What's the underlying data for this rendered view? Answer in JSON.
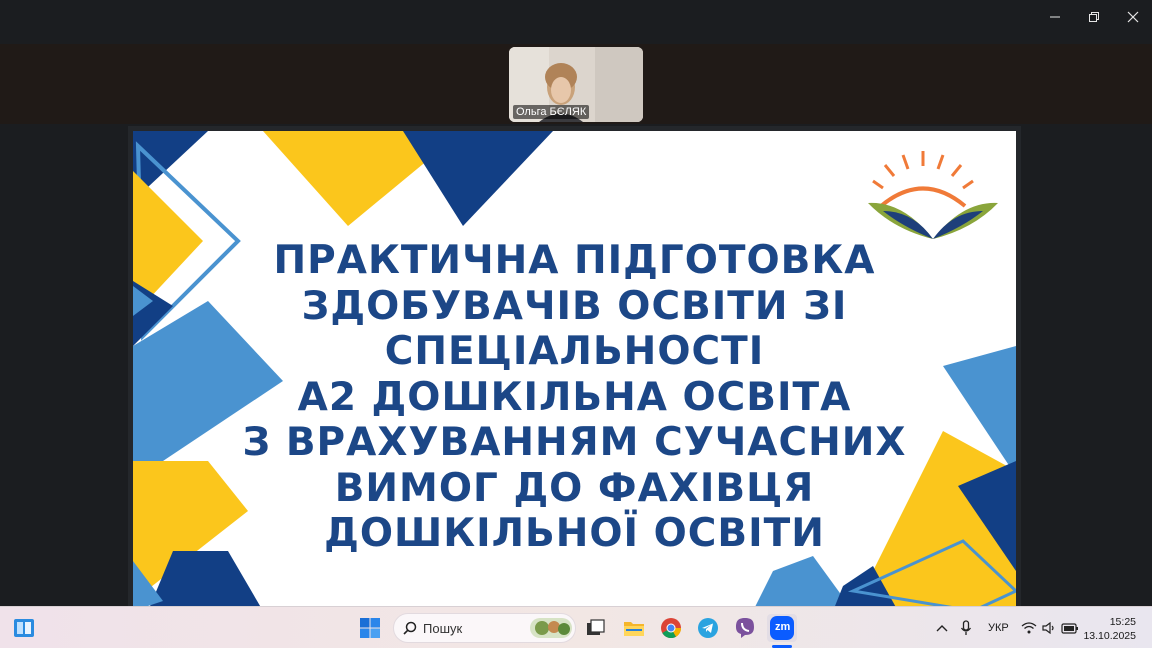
{
  "window": {
    "controls": [
      {
        "name": "minimize",
        "icon": "minimize-icon"
      },
      {
        "name": "restore",
        "icon": "restore-icon"
      },
      {
        "name": "close",
        "icon": "close-icon"
      }
    ]
  },
  "participant": {
    "name": "Ольга БЄЛЯК"
  },
  "slide": {
    "title_lines": [
      "ПРАКТИЧНА ПІДГОТОВКА",
      "ЗДОБУВАЧІВ ОСВІТИ ЗІ",
      "СПЕЦІАЛЬНОСТІ",
      "А2 ДОШКІЛЬНА ОСВІТА",
      "З ВРАХУВАННЯМ СУЧАСНИХ",
      "ВИМОГ ДО ФАХІВЦЯ",
      "ДОШКІЛЬНОЇ ОСВІТИ"
    ],
    "colors": {
      "title": "#1c4787",
      "navy": "#123f85",
      "yellow": "#fbc61c",
      "light_blue": "#4a93d0",
      "logo_sun": "#f07a38",
      "logo_green": "#8aa53b"
    }
  },
  "taskbar": {
    "search_placeholder": "Пошук",
    "apps": [
      "start-icon",
      "task-view-icon",
      "file-explorer-icon",
      "chrome-icon",
      "telegram-icon",
      "viber-icon",
      "zoom-icon"
    ],
    "zoom_label": "zm",
    "language": "УКР",
    "time": "15:25",
    "date": "13.10.2025"
  }
}
